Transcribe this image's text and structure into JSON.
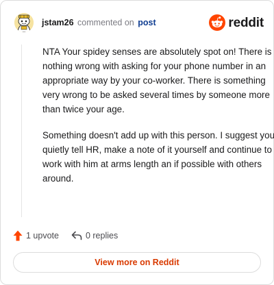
{
  "header": {
    "username": "jstam26",
    "action_text": "commented on",
    "post_link": "post",
    "brand_word": "reddit"
  },
  "comment": {
    "paragraphs": [
      "NTA Your spidey senses are absolutely spot on! There is nothing wrong with asking for your phone number in an appropriate way by your co-worker. There is something very wrong to be asked several times by someone more than twice your age.",
      "Something doesn't add up with this person. I suggest you quietly tell HR, make a note of it yourself and continue to work with him at arms length an if possible with others around."
    ]
  },
  "actions": {
    "upvote_label": "1 upvote",
    "replies_label": "0 replies"
  },
  "footer": {
    "view_more_label": "View more on Reddit"
  },
  "icons": {
    "avatar": "snoo-avatar-icon",
    "brand": "reddit-logo-icon",
    "upvote": "upvote-arrow-icon",
    "reply": "reply-arrow-icon"
  },
  "colors": {
    "accent": "#d93a00",
    "brand_orange": "#ff4500",
    "link_blue": "#0f3d91",
    "muted_text": "#7c7c83"
  }
}
